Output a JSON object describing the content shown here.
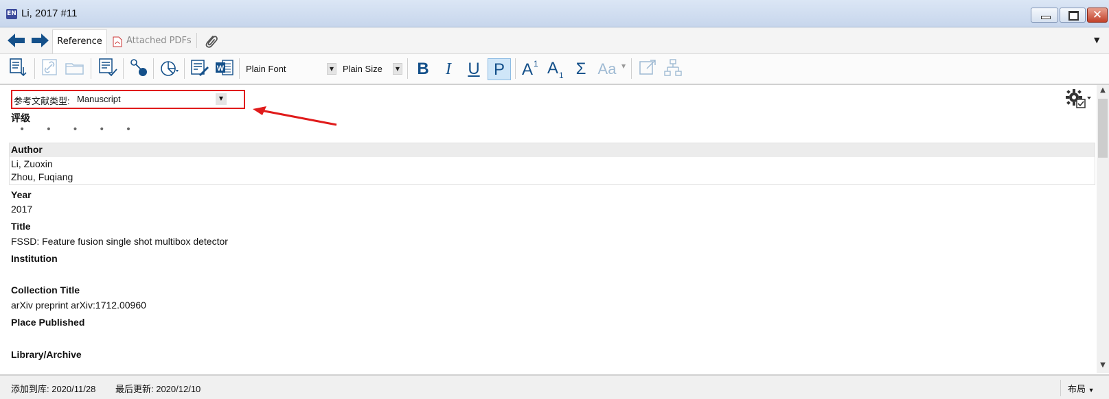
{
  "window": {
    "app_badge": "EN",
    "title": "Li, 2017 #11"
  },
  "tabs": {
    "reference_label": "Reference",
    "attached_pdfs_label": "Attached PDFs"
  },
  "toolbar": {
    "font_value": "Plain Font",
    "size_value": "Plain Size",
    "bold_label": "B",
    "italic_label": "I",
    "underline_label": "U",
    "plain_label": "P",
    "sigma_label": "Σ",
    "case_label": "Aa"
  },
  "reference": {
    "type_label": "参考文献类型:",
    "type_value": "Manuscript",
    "fields": {
      "rating_label": "评级",
      "rating_dots": "• • • • •",
      "author_label": "Author",
      "authors": [
        "Li, Zuoxin",
        "Zhou, Fuqiang"
      ],
      "year_label": "Year",
      "year_value": "2017",
      "title_label": "Title",
      "title_value": "FSSD: Feature fusion single shot multibox detector",
      "institution_label": "Institution",
      "collection_title_label": "Collection Title",
      "collection_title_value": "arXiv preprint arXiv:1712.00960",
      "place_published_label": "Place Published",
      "library_archive_label": "Library/Archive"
    }
  },
  "status": {
    "added": "添加到库: 2020/11/28",
    "updated": "最后更新: 2020/12/10",
    "layout_label": "布局"
  },
  "colors": {
    "accent_blue": "#14508a",
    "highlight_red": "#e01b1b",
    "plain_selected_bg": "#cfe6f8"
  }
}
